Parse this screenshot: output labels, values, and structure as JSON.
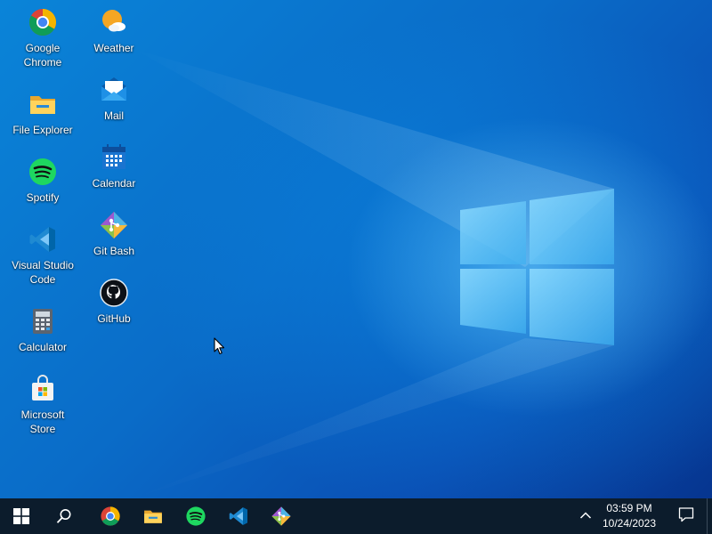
{
  "desktop": {
    "icons": [
      {
        "label": "Google Chrome",
        "icon": "chrome-icon"
      },
      {
        "label": "File Explorer",
        "icon": "folder-icon"
      },
      {
        "label": "Spotify",
        "icon": "spotify-icon"
      },
      {
        "label": "Visual Studio Code",
        "icon": "vscode-icon"
      },
      {
        "label": "Calculator",
        "icon": "calculator-icon"
      },
      {
        "label": "Microsoft Store",
        "icon": "store-icon"
      },
      {
        "label": "Weather",
        "icon": "weather-icon"
      },
      {
        "label": "Mail",
        "icon": "mail-icon"
      },
      {
        "label": "Calendar",
        "icon": "calendar-icon"
      },
      {
        "label": "Git Bash",
        "icon": "git-icon"
      },
      {
        "label": "GitHub",
        "icon": "github-icon"
      }
    ]
  },
  "taskbar": {
    "pinned": [
      "start-icon",
      "search-icon",
      "chrome-icon",
      "folder-icon",
      "spotify-icon",
      "vscode-icon",
      "git-icon"
    ],
    "clock": {
      "time": "03:59 PM",
      "date": "10/24/2023"
    },
    "background": "#0c1c2c"
  },
  "colors": {
    "wallpaper_light": "#0a84d8",
    "wallpaper_dark": "#06358f",
    "logo_glow": "#7fd4ff"
  }
}
